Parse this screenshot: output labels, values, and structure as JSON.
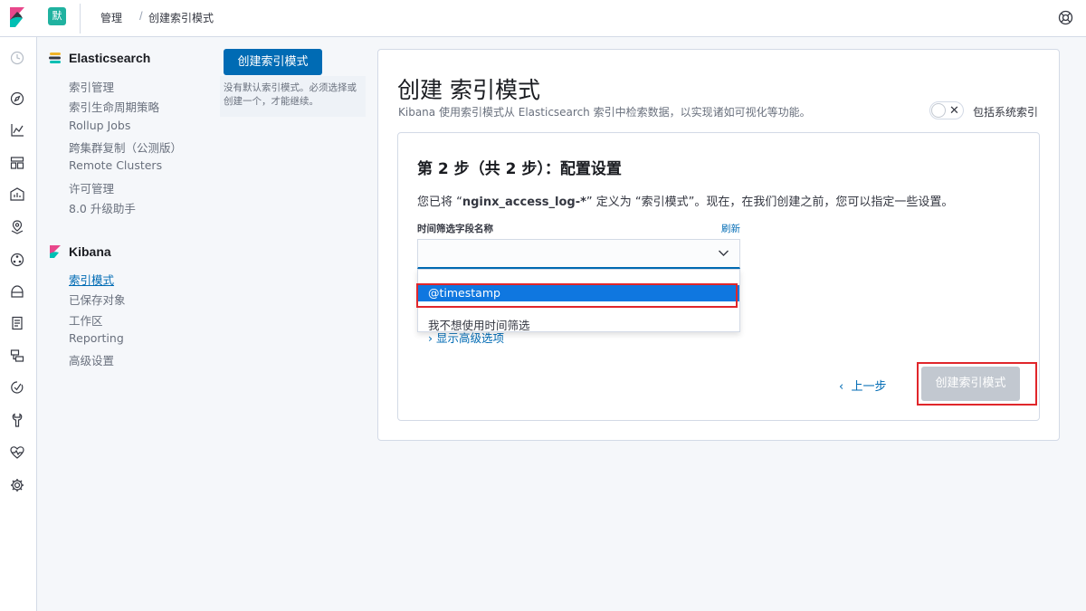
{
  "header": {
    "space_badge": "默",
    "breadcrumbs": [
      "管理",
      "创建索引模式"
    ],
    "separator": "/"
  },
  "sidebar": {
    "sections": [
      {
        "title": "Elasticsearch",
        "items": [
          "索引管理",
          "索引生命周期策略",
          "Rollup Jobs",
          "跨集群复制（公测版）",
          "Remote Clusters",
          "许可管理",
          "8.0 升级助手"
        ]
      },
      {
        "title": "Kibana",
        "items": [
          "索引模式",
          "已保存对象",
          "工作区",
          "Reporting",
          "高级设置"
        ],
        "active_item": "索引模式"
      }
    ]
  },
  "create_panel": {
    "button_label": "创建索引模式",
    "hint_line1": "没有默认索引模式。必须选择或",
    "hint_line2": "创建一个，才能继续。"
  },
  "main": {
    "title": "创建 索引模式",
    "description": "Kibana 使用索引模式从 Elasticsearch 索引中检索数据，以实现诸如可视化等功能。",
    "toggle_label": "包括系统索引",
    "toggle_on": false
  },
  "step": {
    "title": "第 2 步（共 2 步）：配置设置",
    "desc_prefix": "您已将 “",
    "index_pattern": "nginx_access_log-*",
    "desc_suffix": "” 定义为 “索引模式”。现在，在我们创建之前，您可以指定一些设置。",
    "field_label": "时间筛选字段名称",
    "refresh_label": "刷新",
    "select_value": "",
    "options": [
      "@timestamp",
      "我不想使用时间筛选"
    ],
    "selected_option": "@timestamp",
    "advanced_label": "显示高级选项",
    "prev_label": "上一步",
    "submit_label": "创建索引模式"
  },
  "colors": {
    "primary": "#006bb4",
    "selected_option": "#0f77e0",
    "highlight_box": "#e0262b",
    "disabled_button": "#c2c8d0",
    "space_badge": "#20b2a0"
  }
}
